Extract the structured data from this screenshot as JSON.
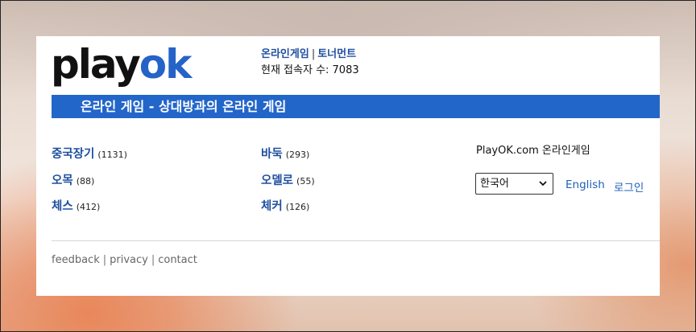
{
  "logo": {
    "part1": "play",
    "part2": "ok"
  },
  "header": {
    "link_online_games": "온라인게임",
    "separator": "|",
    "link_tournaments": "토너먼트",
    "online_count": "현재 접속자 수: 7083"
  },
  "banner": {
    "title": "온라인 게임 - 상대방과의 온라인 게임"
  },
  "games": [
    {
      "label": "중국장기",
      "count": "(1131)"
    },
    {
      "label": "바둑",
      "count": "(293)"
    },
    {
      "label": "오목",
      "count": "(88)"
    },
    {
      "label": "오델로",
      "count": "(55)"
    },
    {
      "label": "체스",
      "count": "(412)"
    },
    {
      "label": "체커",
      "count": "(126)"
    }
  ],
  "sidebar": {
    "title": "PlayOK.com 온라인게임",
    "language_selected": "한국어",
    "english_link": "English",
    "login_link": "로그인"
  },
  "footer": {
    "feedback": "feedback",
    "privacy": "privacy",
    "contact": "contact",
    "separator": "|"
  },
  "colors": {
    "brand_blue": "#2366c9",
    "link_blue": "#1f4fa0"
  }
}
